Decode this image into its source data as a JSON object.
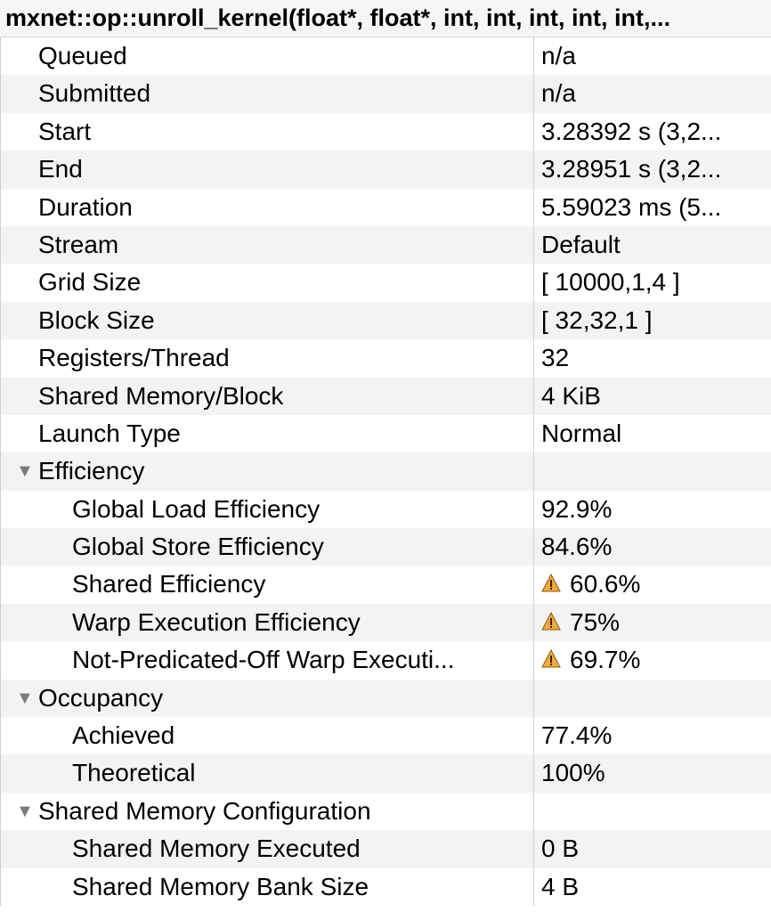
{
  "header": {
    "title": "mxnet::op::unroll_kernel(float*, float*, int, int, int, int, int,..."
  },
  "rows": [
    {
      "label": "Queued",
      "value": "n/a",
      "level": 0
    },
    {
      "label": "Submitted",
      "value": "n/a",
      "level": 0
    },
    {
      "label": "Start",
      "value": "3.28392 s (3,2...",
      "level": 0
    },
    {
      "label": "End",
      "value": "3.28951 s (3,2...",
      "level": 0
    },
    {
      "label": "Duration",
      "value": "5.59023 ms (5...",
      "level": 0
    },
    {
      "label": "Stream",
      "value": "Default",
      "level": 0
    },
    {
      "label": "Grid Size",
      "value": "[ 10000,1,4 ]",
      "level": 0
    },
    {
      "label": "Block Size",
      "value": "[ 32,32,1 ]",
      "level": 0
    },
    {
      "label": "Registers/Thread",
      "value": "32",
      "level": 0
    },
    {
      "label": "Shared  Memory/Block",
      "value": "4 KiB",
      "level": 0
    },
    {
      "label": "Launch Type",
      "value": "Normal",
      "level": 0
    },
    {
      "label": "Efficiency",
      "value": "",
      "level": "group",
      "expanded": true
    },
    {
      "label": "Global Load Efficiency",
      "value": "92.9%",
      "level": 1
    },
    {
      "label": "Global Store Efficiency",
      "value": "84.6%",
      "level": 1
    },
    {
      "label": "Shared Efficiency",
      "value": "60.6%",
      "level": 1,
      "icon": "warning-icon"
    },
    {
      "label": "Warp Execution Efficiency",
      "value": "75%",
      "level": 1,
      "icon": "warning-icon"
    },
    {
      "label": "Not-Predicated-Off Warp Executi...",
      "value": "69.7%",
      "level": 1,
      "icon": "warning-icon"
    },
    {
      "label": "Occupancy",
      "value": "",
      "level": "group",
      "expanded": true
    },
    {
      "label": "Achieved",
      "value": "77.4%",
      "level": 1
    },
    {
      "label": "Theoretical",
      "value": "100%",
      "level": 1
    },
    {
      "label": "Shared Memory Configuration",
      "value": "",
      "level": "group",
      "expanded": true
    },
    {
      "label": "Shared Memory Executed",
      "value": "0 B",
      "level": 1
    },
    {
      "label": "Shared Memory Bank Size",
      "value": "4 B",
      "level": 1
    }
  ],
  "colors": {
    "warning": "#f2a93b",
    "alt_row": "#f3f3f3",
    "toggle": "#7a7a7a"
  }
}
